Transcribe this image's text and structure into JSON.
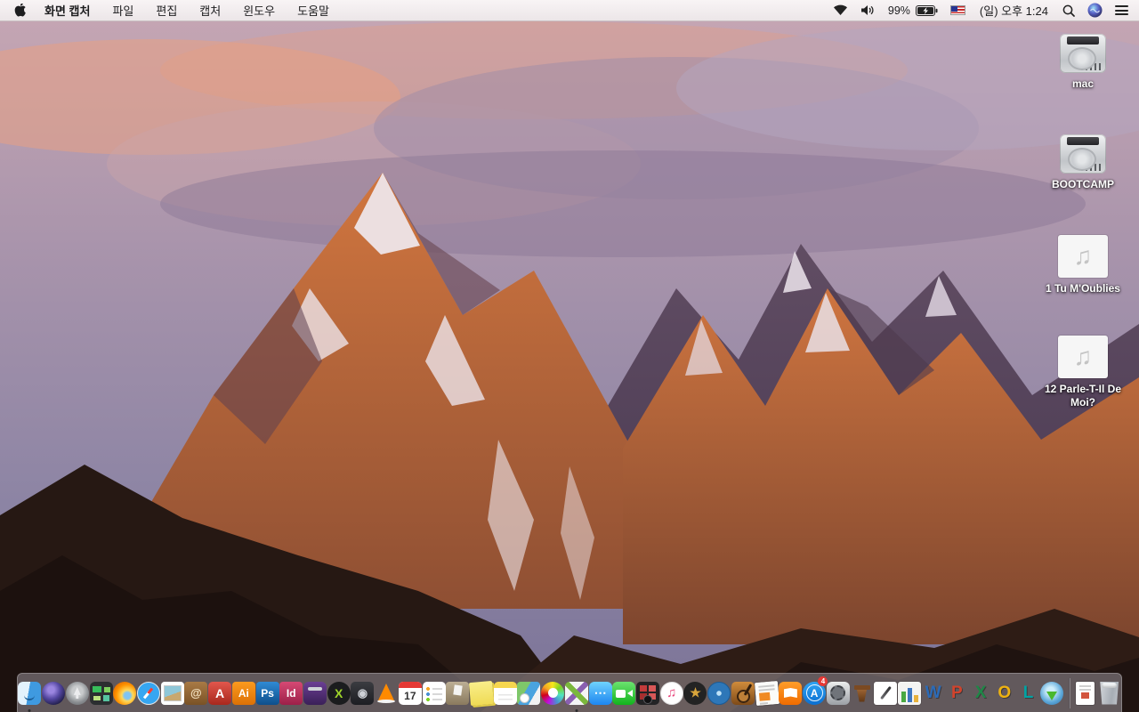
{
  "menu_bar": {
    "app_name": "화면 캡처",
    "menus": [
      {
        "id": "file",
        "label": "파일"
      },
      {
        "id": "edit",
        "label": "편집"
      },
      {
        "id": "capture",
        "label": "캡처"
      },
      {
        "id": "window",
        "label": "윈도우"
      },
      {
        "id": "help",
        "label": "도움말"
      }
    ],
    "status": {
      "battery_percent": "99%",
      "clock": "(일) 오후 1:24",
      "icons": [
        "wifi-icon",
        "volume-icon",
        "battery-charging-icon",
        "us-flag-input-icon",
        "spotlight-search-icon",
        "siri-icon",
        "notification-center-icon"
      ]
    }
  },
  "desktop": {
    "icons": [
      {
        "id": "disk-mac",
        "type": "disk",
        "label": "mac"
      },
      {
        "id": "disk-bootcamp",
        "type": "disk",
        "label": "BOOTCAMP"
      },
      {
        "id": "audio-tu-moublies",
        "type": "audio",
        "label": "1 Tu M'Oublies",
        "glyph": "♫"
      },
      {
        "id": "audio-parle-t-il-de-moi",
        "type": "audio",
        "label": "12 Parle-T-Il De Moi?",
        "glyph": "♫"
      }
    ]
  },
  "dock": {
    "items": [
      {
        "id": "finder",
        "glyph": "",
        "running": true
      },
      {
        "id": "siri",
        "glyph": ""
      },
      {
        "id": "launchpad",
        "glyph": ""
      },
      {
        "id": "mission",
        "glyph": ""
      },
      {
        "id": "firefox",
        "glyph": ""
      },
      {
        "id": "safari",
        "glyph": ""
      },
      {
        "id": "preview",
        "glyph": ""
      },
      {
        "id": "contacts",
        "glyph": "@"
      },
      {
        "id": "acrobat",
        "glyph": "A"
      },
      {
        "id": "illustrator",
        "glyph": "Ai"
      },
      {
        "id": "photoshop",
        "glyph": "Ps"
      },
      {
        "id": "indesign",
        "glyph": "Id"
      },
      {
        "id": "toast",
        "glyph": ""
      },
      {
        "id": "xee",
        "glyph": "X"
      },
      {
        "id": "disktool",
        "glyph": "◉"
      },
      {
        "id": "vlc",
        "glyph": ""
      },
      {
        "id": "calendar",
        "glyph": "17"
      },
      {
        "id": "reminders",
        "glyph": ""
      },
      {
        "id": "appcleaner",
        "glyph": ""
      },
      {
        "id": "stickies",
        "glyph": ""
      },
      {
        "id": "notes",
        "glyph": ""
      },
      {
        "id": "cards",
        "glyph": ""
      },
      {
        "id": "photos",
        "glyph": ""
      },
      {
        "id": "unarchiver",
        "glyph": "",
        "running": true
      },
      {
        "id": "messages",
        "glyph": "⋯"
      },
      {
        "id": "facetime",
        "glyph": ""
      },
      {
        "id": "photobooth",
        "glyph": ""
      },
      {
        "id": "itunes",
        "glyph": "♫"
      },
      {
        "id": "imovie",
        "glyph": "★"
      },
      {
        "id": "idvd",
        "glyph": ""
      },
      {
        "id": "garageband",
        "glyph": ""
      },
      {
        "id": "newsletter",
        "glyph": ""
      },
      {
        "id": "ibooks",
        "glyph": ""
      },
      {
        "id": "appstore",
        "glyph": "A",
        "badge": "4"
      },
      {
        "id": "sysprefs",
        "glyph": ""
      },
      {
        "id": "keynote",
        "glyph": ""
      },
      {
        "id": "pages",
        "glyph": ""
      },
      {
        "id": "numbers",
        "glyph": ""
      },
      {
        "id": "word",
        "glyph": "W"
      },
      {
        "id": "powerpoint",
        "glyph": "P"
      },
      {
        "id": "excel",
        "glyph": "X"
      },
      {
        "id": "outlook",
        "glyph": "O"
      },
      {
        "id": "lync",
        "glyph": "L"
      },
      {
        "id": "downloader",
        "glyph": ""
      },
      {
        "id": "separator"
      },
      {
        "id": "document",
        "glyph": ""
      },
      {
        "id": "trash",
        "glyph": ""
      }
    ]
  },
  "colors": {
    "menubar_bg": "#f4eff1",
    "dock_bg": "rgba(165,160,168,0.5)",
    "badge_red": "#e53935",
    "sky_top": "#c7a9b7",
    "rock_orange": "#c96f3e",
    "foreground_rock": "#261813"
  }
}
